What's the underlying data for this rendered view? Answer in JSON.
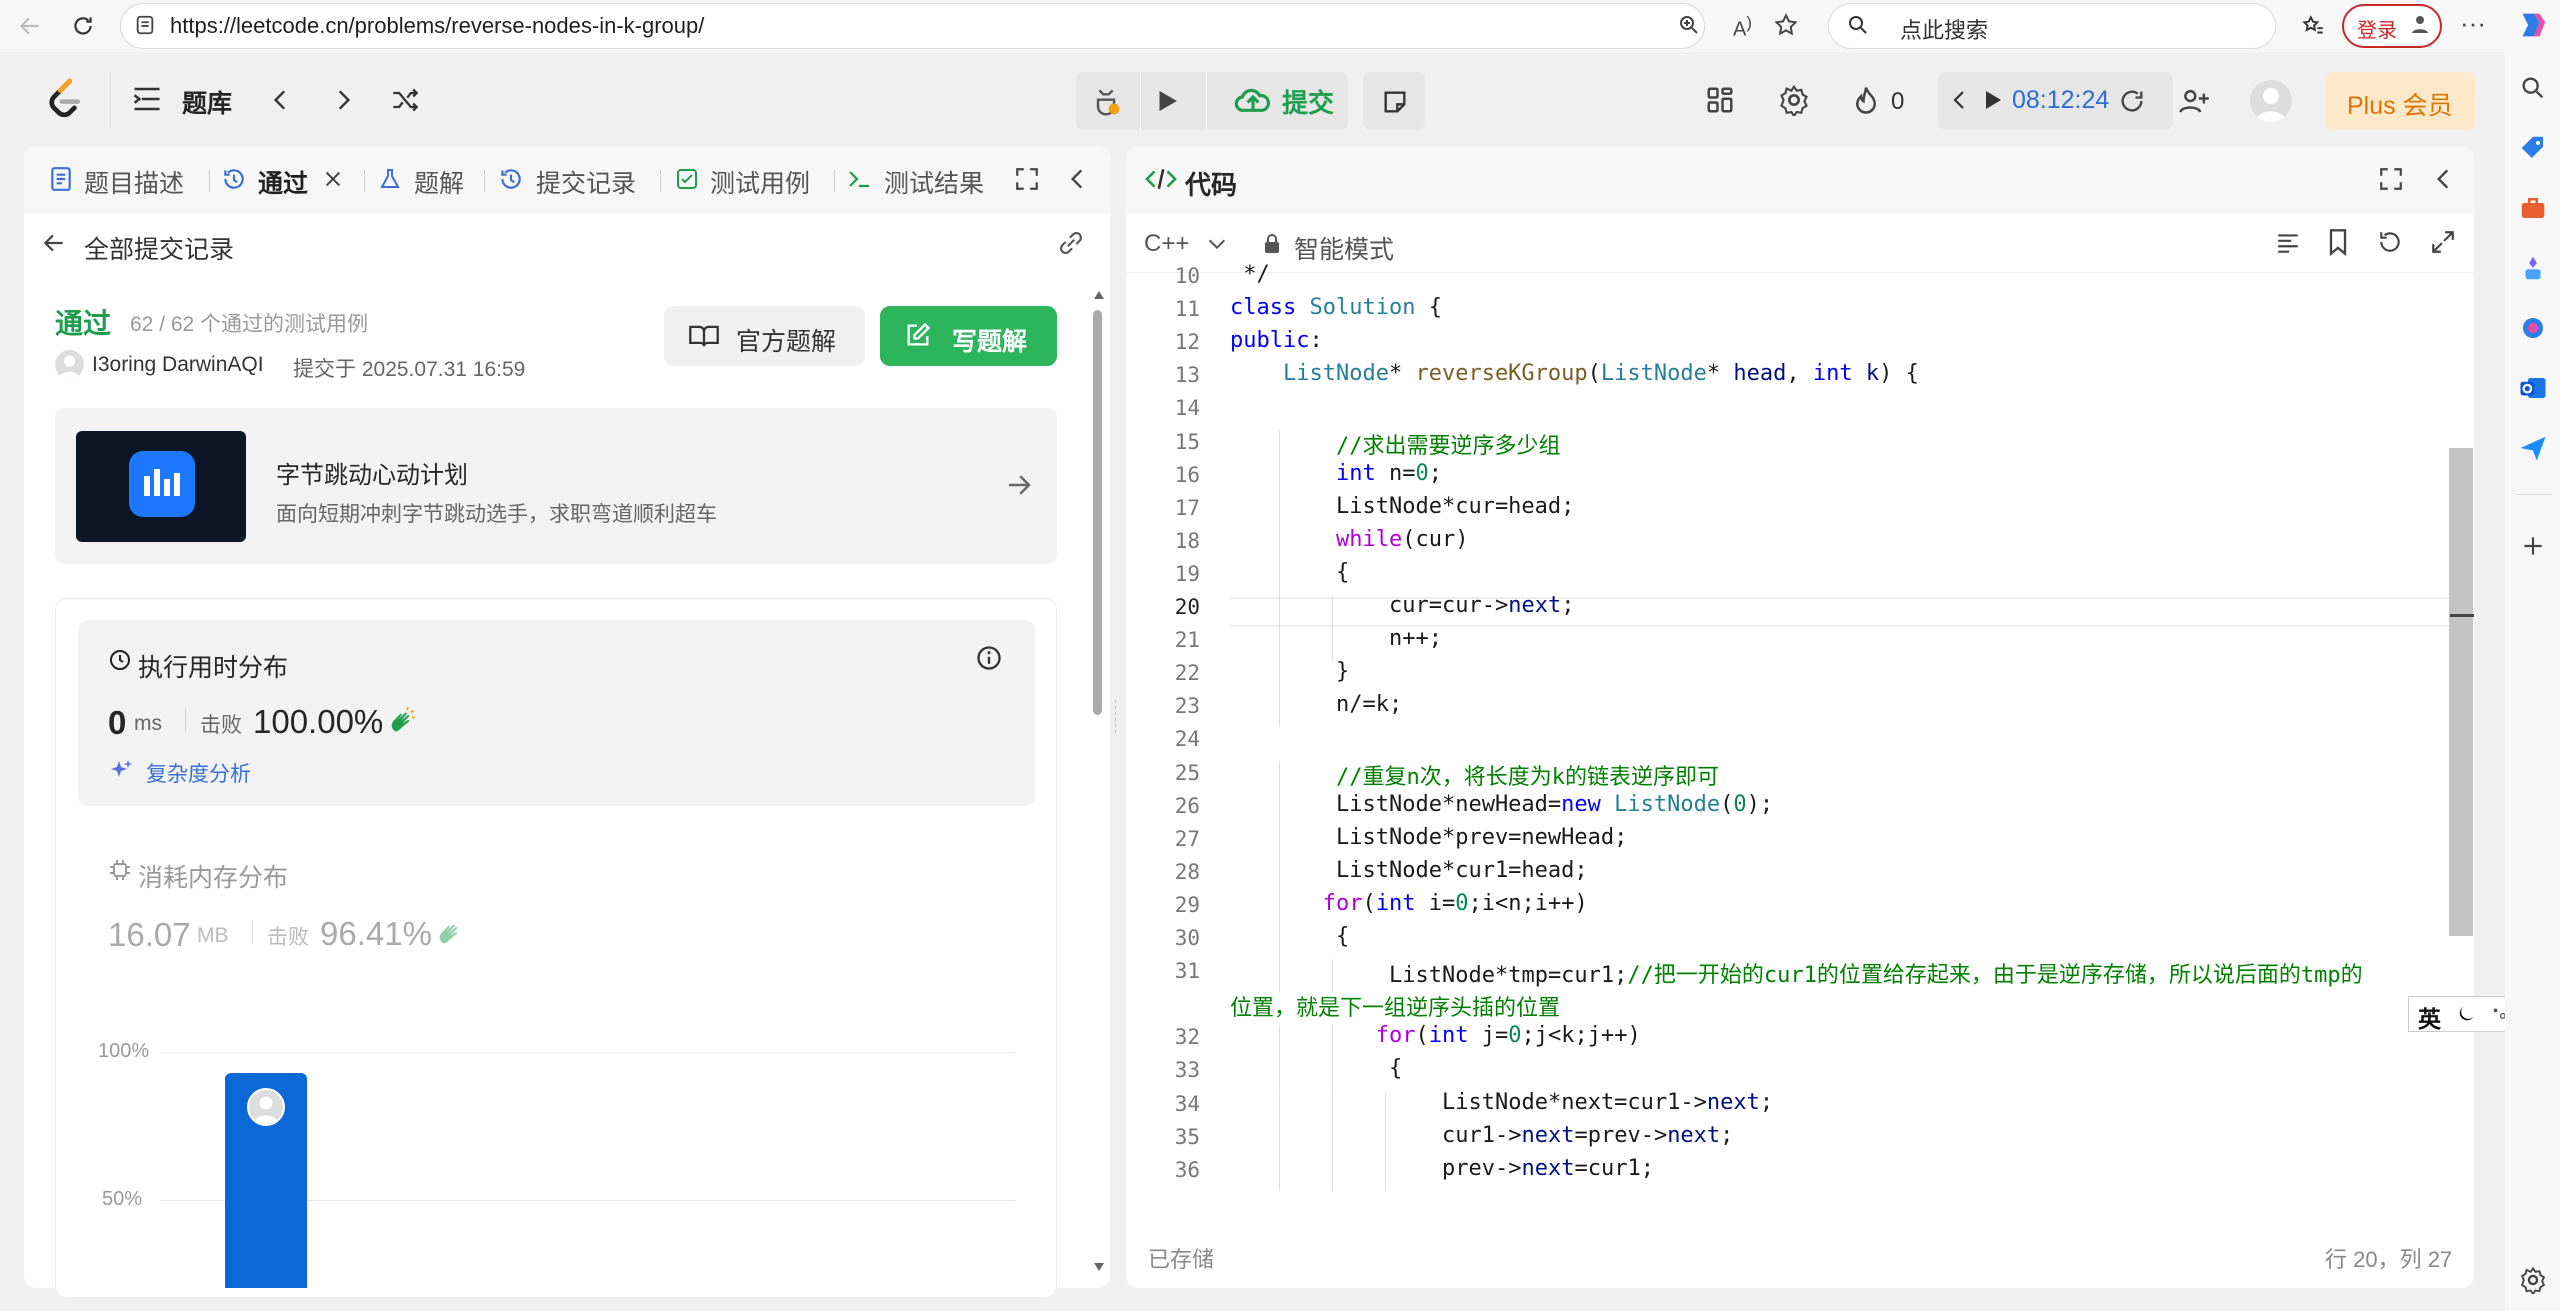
{
  "browser": {
    "url": "https://leetcode.cn/problems/reverse-nodes-in-k-group/",
    "search_placeholder": "点此搜索",
    "login_label": "登录"
  },
  "header": {
    "tiku_label": "题库",
    "submit_label": "提交",
    "timer": "08:12:24",
    "fire_count": "0",
    "plus_label": "Plus 会员"
  },
  "left_tabs": [
    {
      "label": "题目描述"
    },
    {
      "label": "通过"
    },
    {
      "label": "题解"
    },
    {
      "label": "提交记录"
    },
    {
      "label": "测试用例"
    },
    {
      "label": "测试结果"
    }
  ],
  "submission": {
    "back_label": "全部提交记录",
    "status": "通过",
    "passed_text": "62 / 62 个通过的测试用例",
    "author": "I3oring DarwinAQI",
    "submitted_at": "提交于 2025.07.31 16:59",
    "official_solution_label": "官方题解",
    "write_solution_label": "写题解"
  },
  "banner": {
    "title": "字节跳动心动计划",
    "subtitle": "面向短期冲刺字节跳动选手，求职弯道顺利超车"
  },
  "runtime": {
    "title": "执行用时分布",
    "value": "0",
    "unit": "ms",
    "beat_label": "击败",
    "beat_pct": "100.00%",
    "complexity_label": "复杂度分析"
  },
  "memory": {
    "title": "消耗内存分布",
    "value": "16.07",
    "unit": "MB",
    "beat_label": "击败",
    "beat_pct": "96.41%"
  },
  "chart_data": {
    "type": "bar",
    "y_ticks": [
      "100%",
      "50%"
    ],
    "bar_value_pct": 93
  },
  "editor": {
    "title": "代码",
    "language": "C++",
    "mode": "智能模式",
    "saved_label": "已存储",
    "cursor_position": "行 20，列 27",
    "active_line": 20
  },
  "code_lines": [
    {
      "n": "10",
      "indent": 0,
      "html": " */"
    },
    {
      "n": "11",
      "indent": 0,
      "html": "<span class=\"kw\">class</span> <span class=\"ty\">Solution</span> {"
    },
    {
      "n": "12",
      "indent": 0,
      "html": "<span class=\"kw\">public</span>:"
    },
    {
      "n": "13",
      "indent": 1,
      "html": "<span class=\"ty\">ListNode</span>* <span class=\"fn\">reverseKGroup</span>(<span class=\"ty\">ListNode</span>* <span class=\"mb\">head</span>, <span class=\"kw\">int</span> <span class=\"mb\">k</span>) {"
    },
    {
      "n": "14",
      "indent": 0,
      "html": ""
    },
    {
      "n": "15",
      "indent": 2,
      "html": "<span class=\"cm\">//求出需要逆序多少组</span>"
    },
    {
      "n": "16",
      "indent": 2,
      "html": "<span class=\"kw\">int</span> n=<span class=\"nm\">0</span>;"
    },
    {
      "n": "17",
      "indent": 2,
      "html": "ListNode*cur=head;"
    },
    {
      "n": "18",
      "indent": 2,
      "html": "<span class=\"pk\">while</span>(cur)"
    },
    {
      "n": "19",
      "indent": 2,
      "html": "{"
    },
    {
      "n": "20",
      "indent": 3,
      "html": "cur=cur-><span class=\"mb\">next</span>;"
    },
    {
      "n": "21",
      "indent": 3,
      "html": "n++;"
    },
    {
      "n": "22",
      "indent": 2,
      "html": "}"
    },
    {
      "n": "23",
      "indent": 2,
      "html": "n/=k;"
    },
    {
      "n": "24",
      "indent": 0,
      "html": ""
    },
    {
      "n": "25",
      "indent": 2,
      "html": "<span class=\"cm\">//重复n次，将长度为k的链表逆序即可</span>"
    },
    {
      "n": "26",
      "indent": 2,
      "html": "ListNode*newHead=<span class=\"kw\">new</span> <span class=\"ty\">ListNode</span>(<span class=\"nm\">0</span>);"
    },
    {
      "n": "27",
      "indent": 2,
      "html": "ListNode*prev=newHead;"
    },
    {
      "n": "28",
      "indent": 2,
      "html": "ListNode*cur1=head;"
    },
    {
      "n": "29",
      "indent": 1.75,
      "html": "<span class=\"pk\">for</span>(<span class=\"kw\">int</span> i=<span class=\"nm\">0</span>;i&lt;n;i++)"
    },
    {
      "n": "30",
      "indent": 2,
      "html": "{"
    },
    {
      "n": "31",
      "indent": 3,
      "html": "ListNode*tmp=cur1;<span class=\"cm\">//把一开始的cur1的位置给存起来，由于是逆序存储，所以说后面的tmp的</span>"
    },
    {
      "n": "",
      "indent": 0,
      "html": "<span class=\"cm\">位置，就是下一组逆序头插的位置</span>"
    },
    {
      "n": "32",
      "indent": 2.75,
      "html": "<span class=\"pk\">for</span>(<span class=\"kw\">int</span> j=<span class=\"nm\">0</span>;j&lt;k;j++)"
    },
    {
      "n": "33",
      "indent": 3,
      "html": "{"
    },
    {
      "n": "34",
      "indent": 4,
      "html": "ListNode*next=cur1-><span class=\"mb\">next</span>;"
    },
    {
      "n": "35",
      "indent": 4,
      "html": "cur1-><span class=\"mb\">next</span>=prev-><span class=\"mb\">next</span>;"
    },
    {
      "n": "36",
      "indent": 4,
      "html": "prev-><span class=\"mb\">next</span>=cur1;"
    }
  ],
  "ime": {
    "label": "英"
  }
}
